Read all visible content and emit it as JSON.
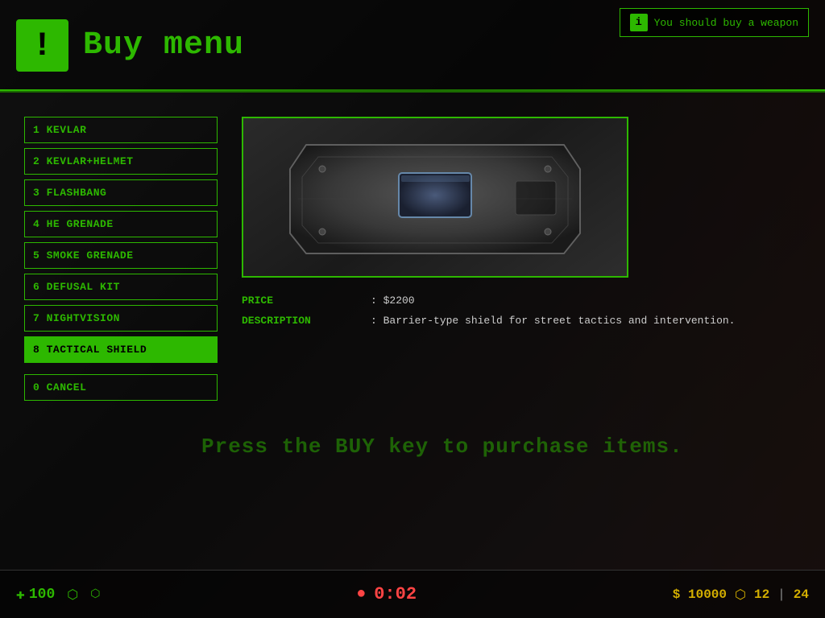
{
  "header": {
    "icon_label": "!",
    "title": "Buy menu"
  },
  "notification": {
    "icon": "i",
    "message": "You should buy a weapon"
  },
  "menu_items": [
    {
      "id": 1,
      "key": "1",
      "label": "1 KEVLAR",
      "selected": false
    },
    {
      "id": 2,
      "key": "2",
      "label": "2 KEVLAR+HELMET",
      "selected": false
    },
    {
      "id": 3,
      "key": "3",
      "label": "3 FLASHBANG",
      "selected": false
    },
    {
      "id": 4,
      "key": "4",
      "label": "4 HE GRENADE",
      "selected": false
    },
    {
      "id": 5,
      "key": "5",
      "label": "5 SMOKE GRENADE",
      "selected": false
    },
    {
      "id": 6,
      "key": "6",
      "label": "6 DEFUSAL KIT",
      "selected": false
    },
    {
      "id": 7,
      "key": "7",
      "label": "7 NIGHTVISION",
      "selected": false
    },
    {
      "id": 8,
      "key": "8",
      "label": "8 TACTICAL SHIELD",
      "selected": true
    },
    {
      "id": 0,
      "key": "0",
      "label": "0 CANCEL",
      "selected": false
    }
  ],
  "item_detail": {
    "price_label": "PRICE",
    "price_value": ": $2200",
    "description_label": "DESCRIPTION",
    "description_value": ": Barrier-type shield for street tactics and intervention."
  },
  "press_buy": {
    "text": "Press the BUY key to purchase items."
  },
  "hud": {
    "health_icon": "+",
    "health_value": "100",
    "armor_icon": "⬡",
    "bomb_icon": "●",
    "timer": "0:02",
    "money": "$ 10000",
    "ammo_current": "12",
    "ammo_reserve": "24"
  },
  "colors": {
    "green": "#2db800",
    "dark_green": "#1a6a00",
    "red": "#ff4444",
    "gold": "#d4af00"
  }
}
